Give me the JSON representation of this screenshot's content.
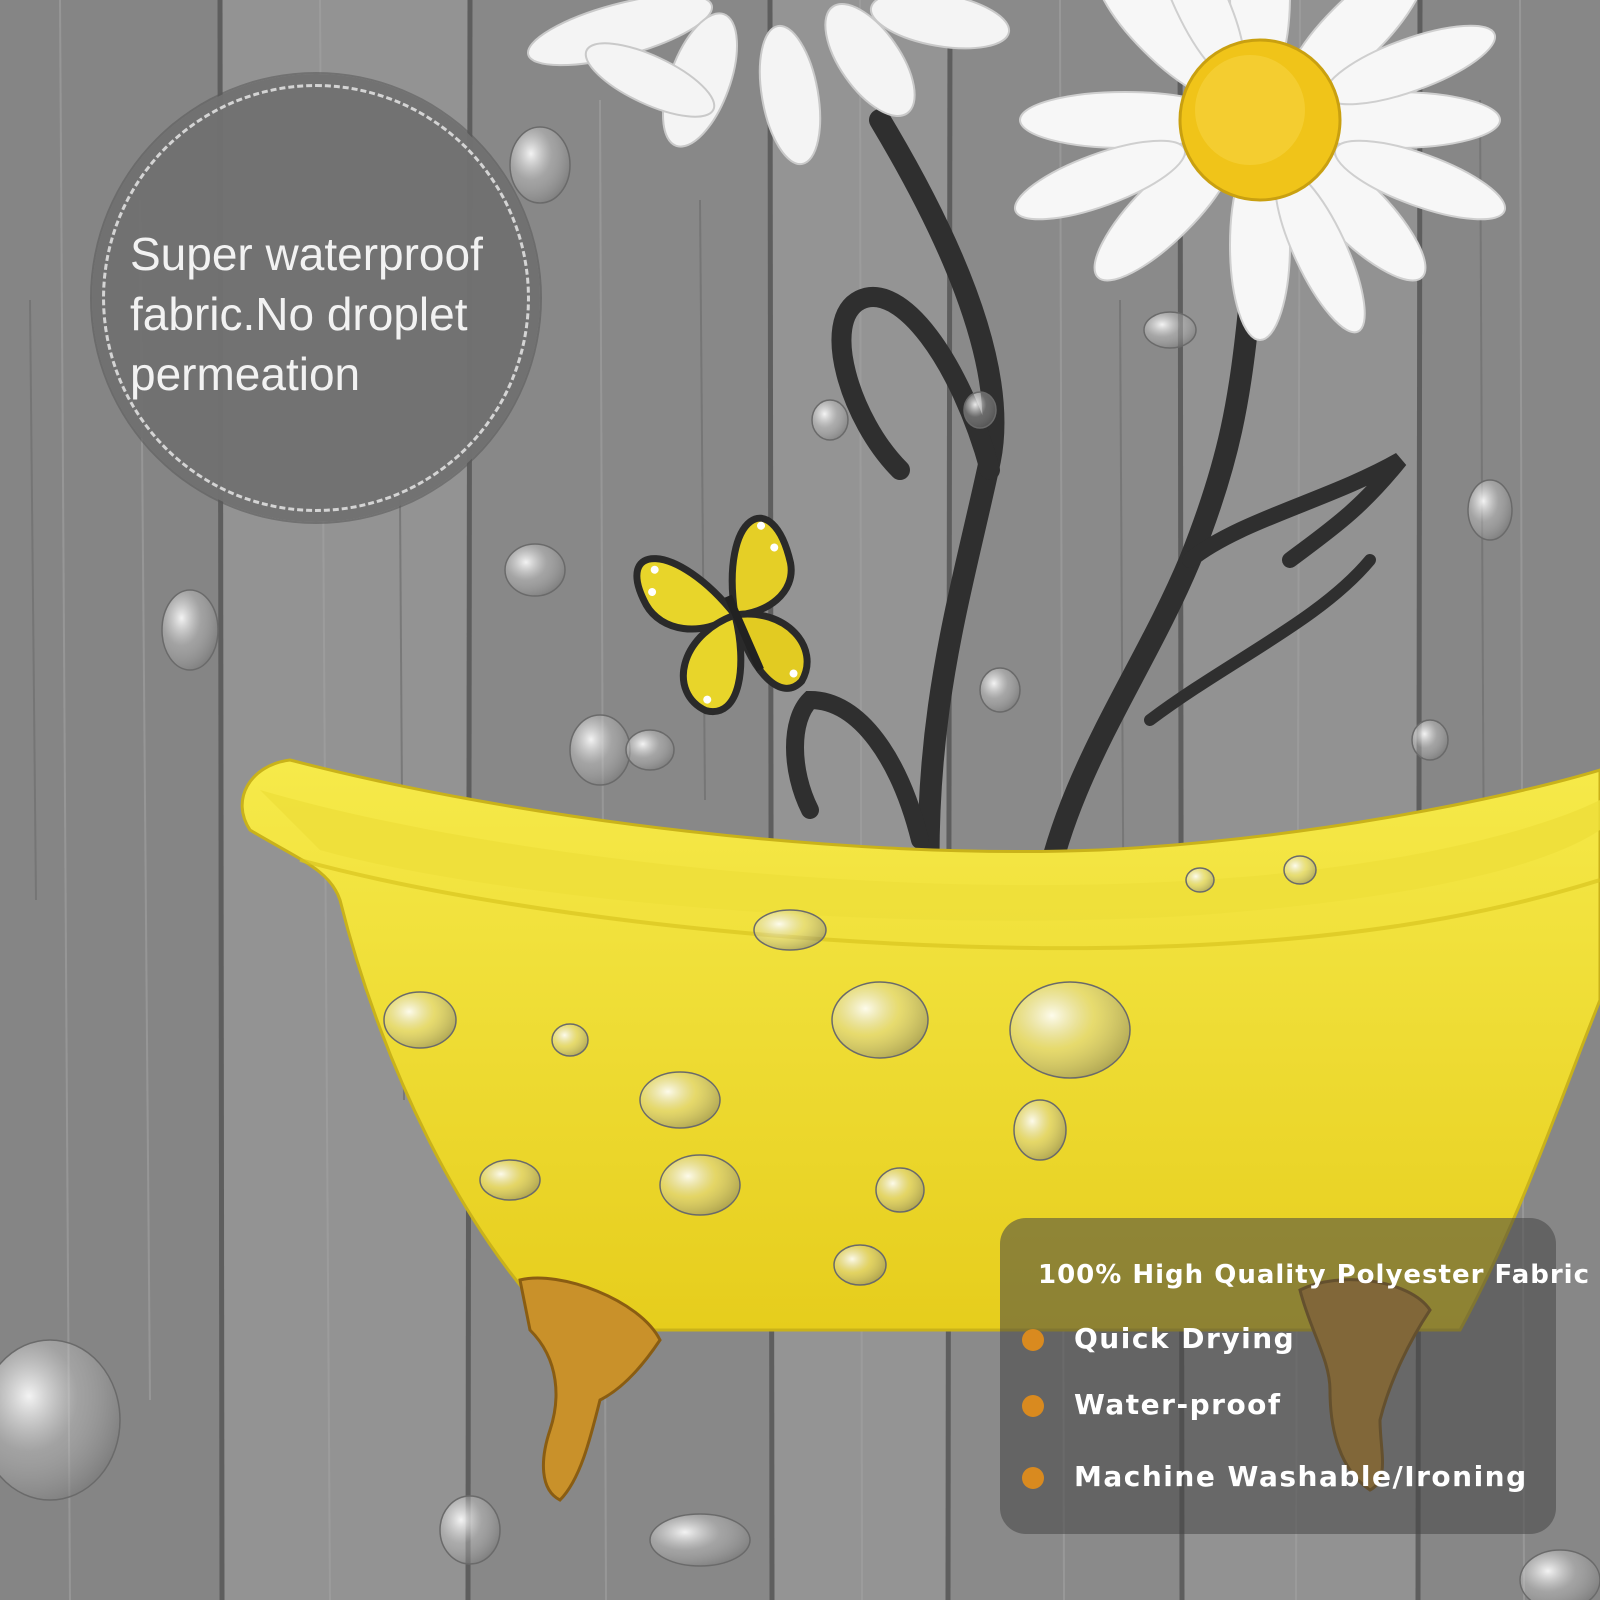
{
  "badge": {
    "lines": [
      "Super waterproof",
      "fabric.No droplet",
      "permeation"
    ]
  },
  "features": {
    "title": "100% High Quality Polyester Fabric",
    "items": [
      "Quick Drying",
      "Water-proof",
      "Machine Washable/Ironing"
    ],
    "bullet_color": "#d98a1f"
  },
  "colors": {
    "wood": "#8c8c8c",
    "tub": "#f2e228",
    "daisy_center": "#f0c419",
    "stem": "#2f2f2f",
    "feet": "#c9912a",
    "butterfly": "#e8d52a"
  },
  "icons": [
    "daisy-flower-icon",
    "butterfly-icon",
    "bathtub-icon",
    "water-droplet-icon"
  ]
}
